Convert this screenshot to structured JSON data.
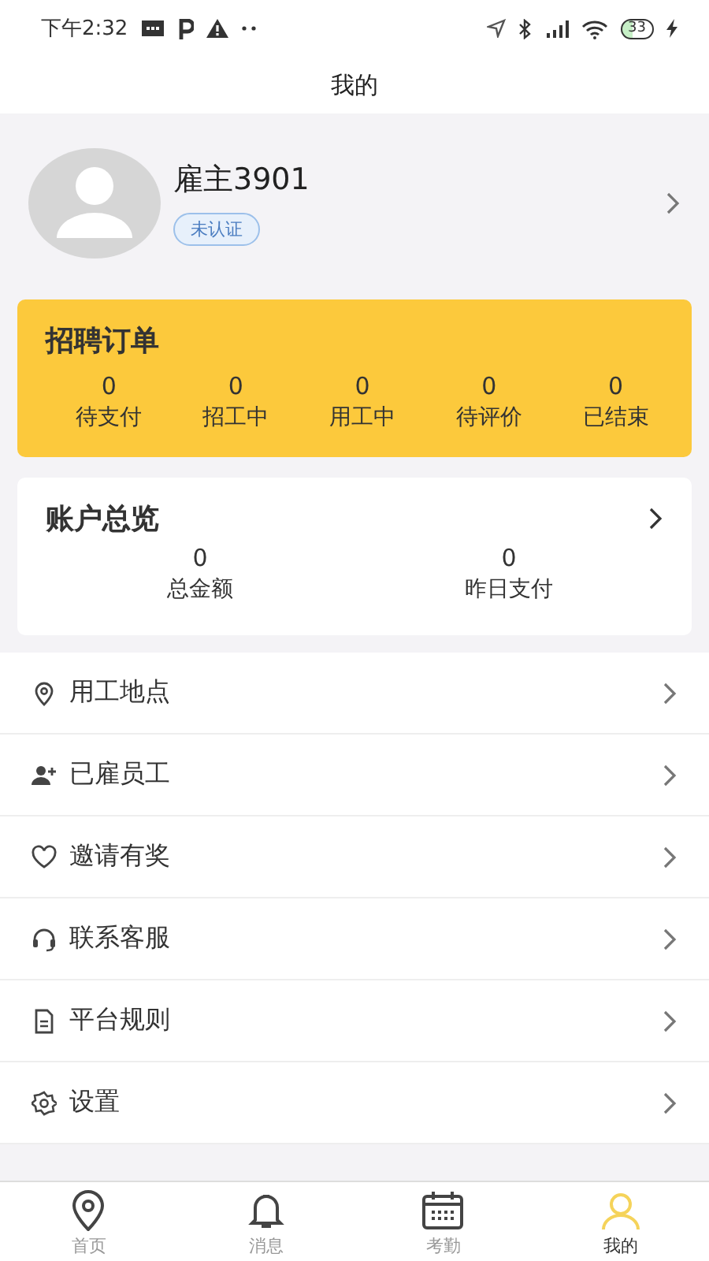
{
  "status_bar": {
    "time": "下午2:32",
    "battery": "33"
  },
  "header": {
    "title": "我的"
  },
  "profile": {
    "name": "雇主3901",
    "badge": "未认证"
  },
  "orders": {
    "title": "招聘订单",
    "stats": [
      {
        "value": "0",
        "label": "待支付"
      },
      {
        "value": "0",
        "label": "招工中"
      },
      {
        "value": "0",
        "label": "用工中"
      },
      {
        "value": "0",
        "label": "待评价"
      },
      {
        "value": "0",
        "label": "已结束"
      }
    ]
  },
  "account": {
    "title": "账户总览",
    "stats": [
      {
        "value": "0",
        "label": "总金额"
      },
      {
        "value": "0",
        "label": "昨日支付"
      }
    ]
  },
  "menu": [
    {
      "label": "用工地点"
    },
    {
      "label": "已雇员工"
    },
    {
      "label": "邀请有奖"
    },
    {
      "label": "联系客服"
    },
    {
      "label": "平台规则"
    },
    {
      "label": "设置"
    }
  ],
  "tabs": [
    {
      "label": "首页",
      "selected": false
    },
    {
      "label": "消息",
      "selected": false
    },
    {
      "label": "考勤",
      "selected": false
    },
    {
      "label": "我的",
      "selected": true
    }
  ]
}
